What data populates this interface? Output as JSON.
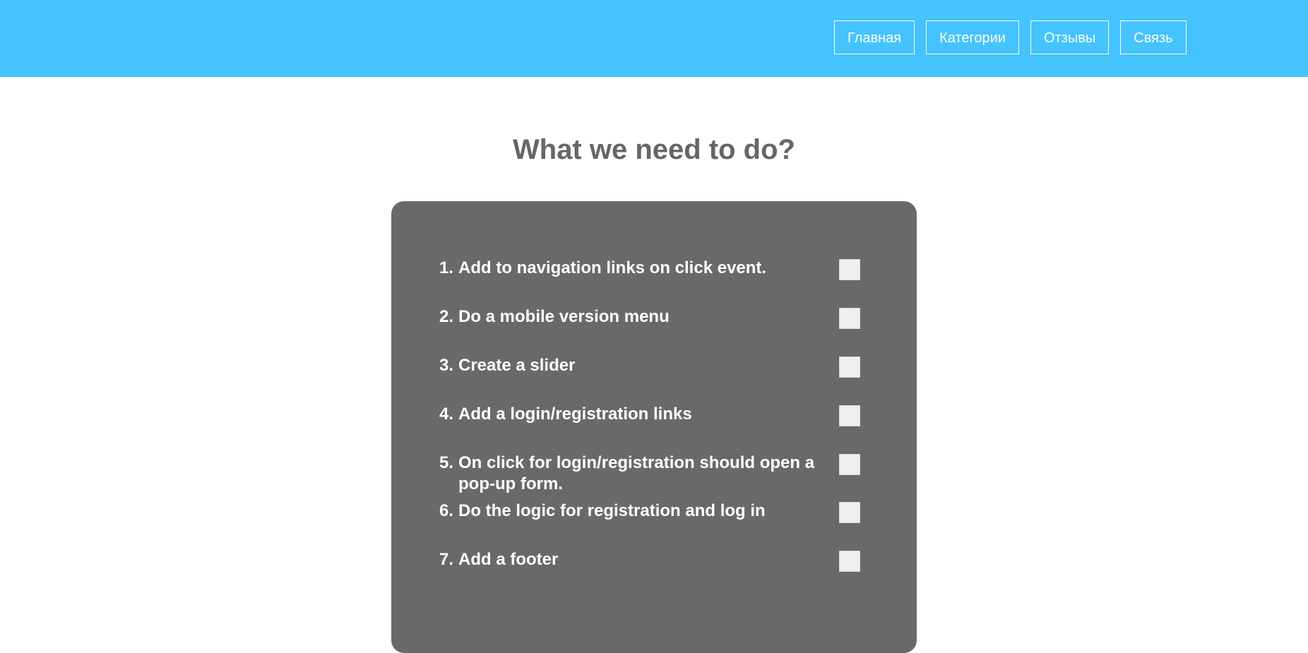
{
  "nav": {
    "items": [
      {
        "label": "Главная"
      },
      {
        "label": "Категории"
      },
      {
        "label": "Отзывы"
      },
      {
        "label": "Связь"
      }
    ]
  },
  "main": {
    "title": "What we need to do?"
  },
  "todo": {
    "items": [
      {
        "num": "1.",
        "text": "Add to navigation links on click event.",
        "checked": false
      },
      {
        "num": "2.",
        "text": "Do a mobile version menu",
        "checked": false
      },
      {
        "num": "3.",
        "text": "Create a slider",
        "checked": false
      },
      {
        "num": "4.",
        "text": "Add a login/registration links",
        "checked": false
      },
      {
        "num": "5.",
        "text": "On click for login/registration should open a pop-up form.",
        "checked": false
      },
      {
        "num": "6.",
        "text": "Do the logic for registration and log in",
        "checked": false
      },
      {
        "num": "7.",
        "text": "Add a footer",
        "checked": false
      }
    ]
  },
  "colors": {
    "header_bg": "#44c3fd",
    "panel_bg": "#696969",
    "title": "#666666",
    "checkbox": "#efefef"
  }
}
